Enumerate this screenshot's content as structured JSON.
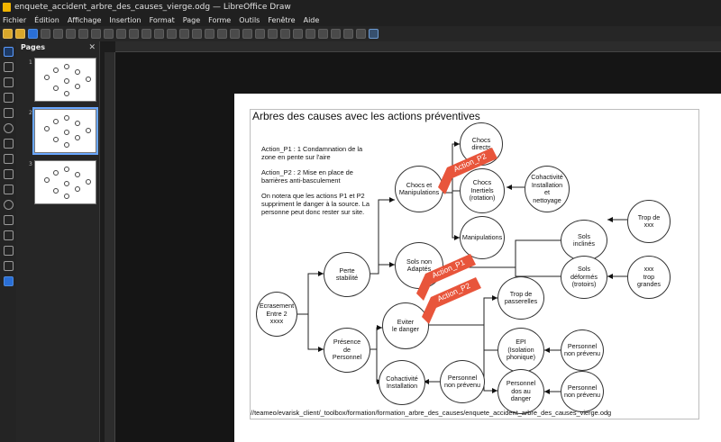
{
  "window": {
    "title": "enquete_accident_arbre_des_causes_vierge.odg — LibreOffice Draw"
  },
  "menu": [
    "Fichier",
    "Édition",
    "Affichage",
    "Insertion",
    "Format",
    "Page",
    "Forme",
    "Outils",
    "Fenêtre",
    "Aide"
  ],
  "pages_panel": {
    "title": "Pages",
    "items": [
      "1",
      "2",
      "3"
    ]
  },
  "slide": {
    "title": "Arbres des causes avec les actions préventives",
    "note_p1": "Action_P1   : 1 Condamnation de la zone en pente sur l'aire",
    "note_p2": "Action_P2  : 2 Mise en place de barrières anti-basculement",
    "note_p3": "On notera que les actions P1 et P2 suppriment le danger à la source. La personne peut donc rester sur site.",
    "path": "//teameo/evarisk_client/_toolbox/formation/formation_arbre_des_causes/enquete_accident_arbre_des_causes_vierge.odg",
    "nodes": {
      "ecrasement": "Ecrasement\nEntre 2\nxxxx",
      "perte": "Perte\nstabilité",
      "presence": "Présence\nde\nPersonnel",
      "chocs_manip": "Chocs et\nManipulations",
      "sols_non": "Sols non\nAdaptés",
      "eviter": "Eviter\nle danger",
      "cohactivite2": "Cohactivité\nInstallation",
      "chocs_directs": "Chocs\ndirects",
      "chocs_inertiels": "Chocs\nInertiels\n(rotation)",
      "cohactivite1": "Cohactivité\nInstallation\net\nnettoyage",
      "manipulations": "Manipulations",
      "sols_inclines": "Sols\ninclinés",
      "trop_xxx": "Trop de\nxxx",
      "sols_deformes": "Sols\ndéformés\n(trotoirs)",
      "xxx_trop": "xxx\ntrop\ngrandes",
      "trop_passerelles": "Trop de\npasserelles",
      "epi": "EPI\n(Isolation\nphonique)",
      "perso_nonprevenu1": "Personnel\nnon prévenu",
      "perso_nonprevenu2": "Personnel\nnon prévenu",
      "perso_dos": "Personnel\ndos au\ndanger",
      "perso_nonprevenu3": "Personnel\nnon prévenu"
    },
    "tags": {
      "p2a": "Action_P2",
      "p1": "Action_P1",
      "p2b": "Action_P2"
    },
    "colors": {
      "tag": "#e8553b",
      "line": "#222222"
    }
  }
}
